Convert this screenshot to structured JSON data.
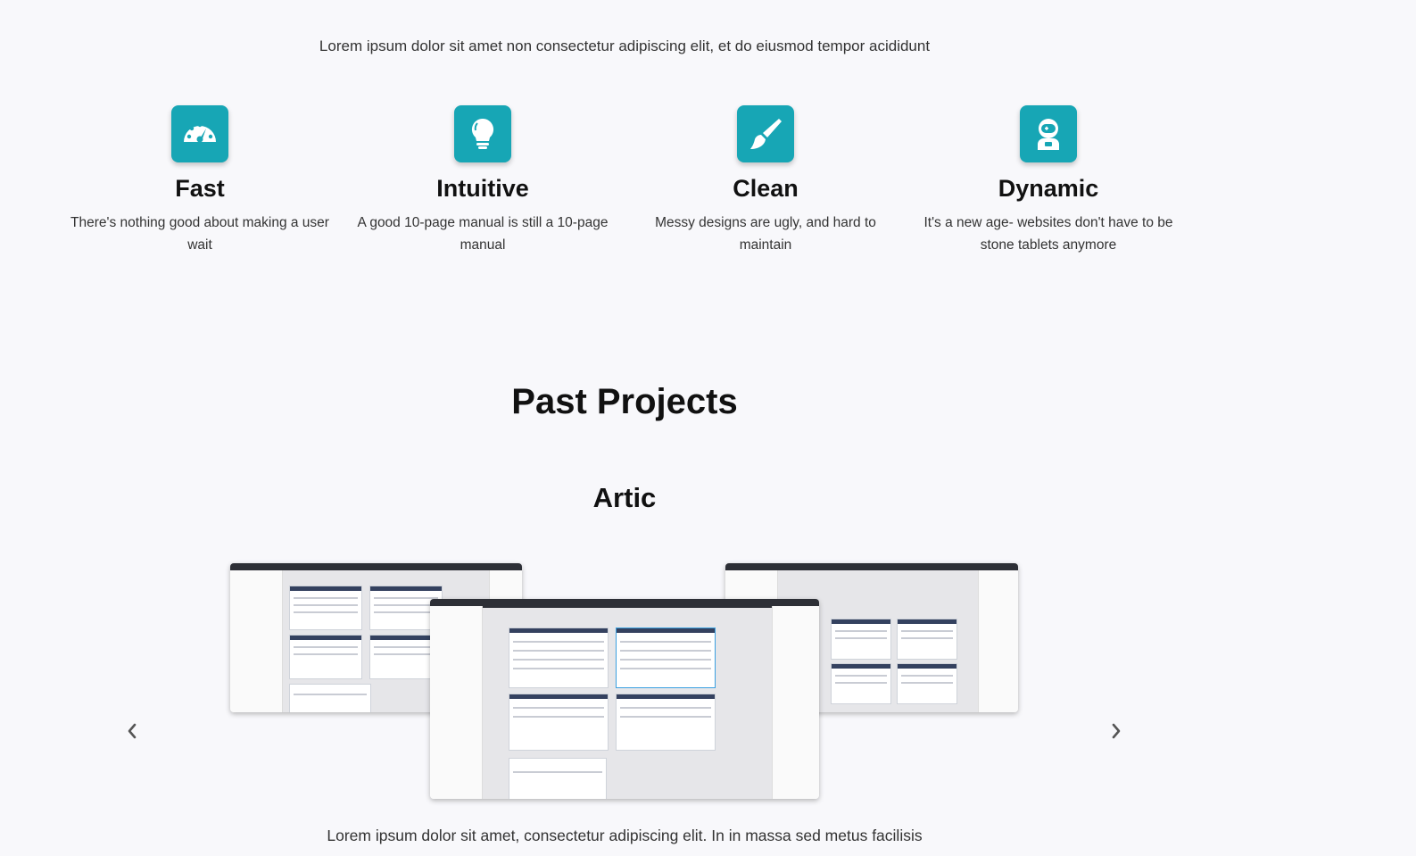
{
  "intro": "Lorem ipsum dolor sit amet non consectetur adipiscing elit, et do eiusmod tempor acididunt",
  "features": [
    {
      "icon": "speedometer-icon",
      "title": "Fast",
      "text": "There's nothing good about making a user wait"
    },
    {
      "icon": "lightbulb-icon",
      "title": "Intuitive",
      "text": "A good 10-page manual is still a 10-page manual"
    },
    {
      "icon": "brush-icon",
      "title": "Clean",
      "text": "Messy designs are ugly, and hard to maintain"
    },
    {
      "icon": "robot-icon",
      "title": "Dynamic",
      "text": "It's a new age- websites don't have to be stone tablets anymore"
    }
  ],
  "colors": {
    "accent": "#17a6b5",
    "background": "#f8f8fb"
  },
  "projects": {
    "heading": "Past Projects",
    "current": {
      "title": "Artic",
      "description": "Lorem ipsum dolor sit amet, consectetur adipiscing elit. In in massa sed metus facilisis"
    },
    "carousel": {
      "prev_icon": "chevron-left-icon",
      "next_icon": "chevron-right-icon"
    }
  }
}
